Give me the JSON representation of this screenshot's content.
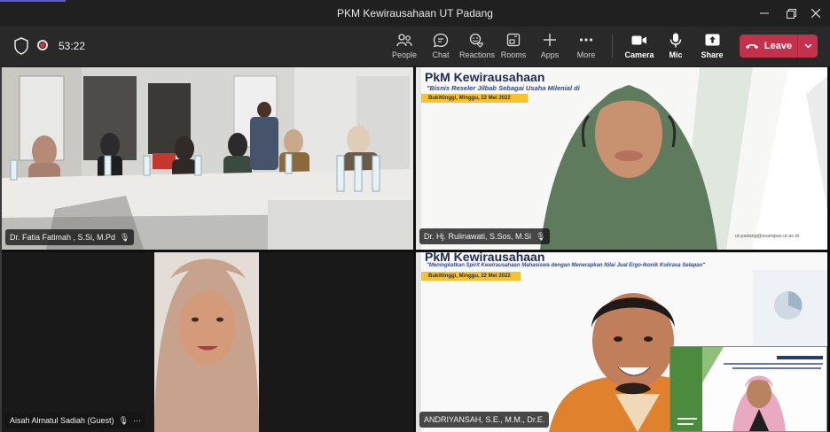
{
  "window": {
    "title": "PKM Kewirausahaan UT Padang",
    "controls": [
      "minimize",
      "maximize",
      "close"
    ]
  },
  "meeting": {
    "timer": "53:22",
    "shield_icon": "shield-icon",
    "recording_icon": "record-icon"
  },
  "toolbar": {
    "buttons": [
      {
        "label": "People",
        "icon": "people-icon"
      },
      {
        "label": "Chat",
        "icon": "chat-icon"
      },
      {
        "label": "Reactions",
        "icon": "reactions-icon"
      },
      {
        "label": "Rooms",
        "icon": "rooms-icon"
      },
      {
        "label": "Apps",
        "icon": "apps-icon"
      },
      {
        "label": "More",
        "icon": "more-icon"
      },
      {
        "label": "Camera",
        "icon": "camera-icon"
      },
      {
        "label": "Mic",
        "icon": "mic-icon"
      },
      {
        "label": "Share",
        "icon": "share-icon"
      }
    ],
    "leave_label": "Leave"
  },
  "tiles": [
    {
      "name": "Dr. Fatia Fatimah , S.Si, M.Pd"
    },
    {
      "name": "Dr. Hj. Rulinawati, S.Sos, M.Si",
      "slide_title": "PkM Kewirausahaan",
      "slide_subtitle": "\"Bisnis Reseler Jilbab Sebagai Usaha Milenial di",
      "slide_date": "Bukittinggi, Minggu, 22 Mei 2022",
      "slide_footer": "ut-padang@ecampus.ut.ac.id"
    },
    {
      "name": "Aisah Almatul Sadiah (Guest)",
      "more": "···"
    },
    {
      "name": "ANDRIYANSAH, S.E., M.M., Dr.E.",
      "slide_title": "PkM Kewirausahaan",
      "slide_subtitle": "\"Meningkatkan Spirit Kewirausahaan Mahasiswa dengan Menerapkan Nilai Jual  Ergo-Ikonik  Kolirasa Selapan\"",
      "slide_date": "Bukittinggi, Minggu, 22 Mei 2022"
    }
  ],
  "colors": {
    "leave": "#c4314b",
    "titlebar": "#202020",
    "toolbar": "#292929",
    "slide_yellow": "#f7c22c",
    "slide_navy": "#1d2a52"
  }
}
